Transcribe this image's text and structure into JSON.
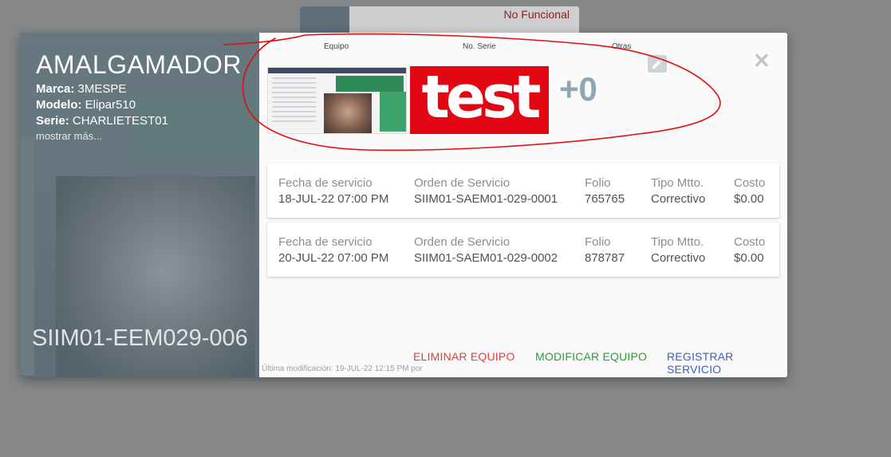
{
  "background_card": {
    "status": "No Funcional"
  },
  "equipment": {
    "name": "AMALGAMADOR",
    "brand_label": "Marca:",
    "brand": "3MESPE",
    "model_label": "Modelo:",
    "model": "Elipar510",
    "serial_label": "Serie:",
    "serial": "CHARLIETEST01",
    "more_link": "mostrar más...",
    "code": "SIIM01-EEM029-006"
  },
  "images": {
    "headers": [
      "Equipo",
      "No. Serie",
      "Otras"
    ],
    "serial_image_text": "test",
    "others_count": "+0"
  },
  "services": [
    {
      "date_label": "Fecha de servicio",
      "date": "18-JUL-22 07:00 PM",
      "order_label": "Orden de Servicio",
      "order": "SIIM01-SAEM01-029-0001",
      "folio_label": "Folio",
      "folio": "765765",
      "type_label": "Tipo Mtto.",
      "type": "Correctivo",
      "cost_label": "Costo",
      "cost": "$0.00"
    },
    {
      "date_label": "Fecha de servicio",
      "date": "20-JUL-22 07:00 PM",
      "order_label": "Orden de Servicio",
      "order": "SIIM01-SAEM01-029-0002",
      "folio_label": "Folio",
      "folio": "878787",
      "type_label": "Tipo Mtto.",
      "type": "Correctivo",
      "cost_label": "Costo",
      "cost": "$0.00"
    }
  ],
  "footer": {
    "last_modified": "Última modificación: 19-JUL-22 12:15 PM por",
    "delete_label": "ELIMINAR EQUIPO",
    "modify_label": "MODIFICAR EQUIPO",
    "register_label": "REGISTRAR SERVICIO"
  },
  "colors": {
    "delete": "#e63c3c",
    "modify": "#2e9a3b",
    "register": "#3b5fbd",
    "annotation": "#e01010"
  },
  "icons": [
    "edit-icon",
    "close-icon"
  ]
}
